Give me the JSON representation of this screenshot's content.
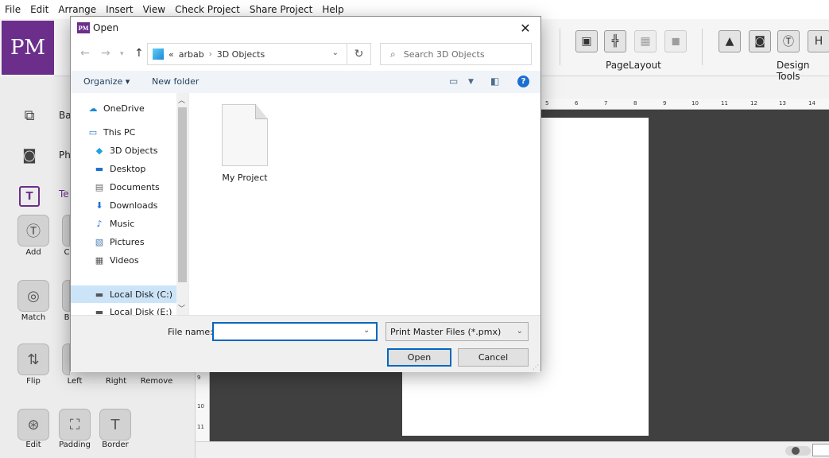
{
  "app": {
    "logo_text": "PM",
    "menu": [
      "File",
      "Edit",
      "Arrange",
      "Insert",
      "View",
      "Check Project",
      "Share Project",
      "Help"
    ],
    "toolbar_groups": [
      "PageLayout",
      "Design Tools"
    ],
    "left_panel": {
      "rows": [
        {
          "label": "Ba",
          "icon": "layers-icon"
        },
        {
          "label": "Ph",
          "icon": "camera-icon"
        },
        {
          "label": "Te",
          "icon": "text-icon"
        }
      ],
      "tools": [
        "Add",
        "C",
        "Match",
        "B",
        "Flip",
        "Left",
        "Right",
        "Remove",
        "Edit",
        "Padding",
        "Border"
      ]
    },
    "ruler_top": [
      "5",
      "6",
      "7",
      "8",
      "9",
      "10",
      "11",
      "12",
      "13",
      "14"
    ],
    "ruler_left": [
      "9",
      "10",
      "11"
    ]
  },
  "dialog": {
    "title": "Open",
    "title_logo": "PM",
    "path": {
      "prefix": "«",
      "segments": [
        "arbab",
        "3D Objects"
      ]
    },
    "search_placeholder": "Search 3D Objects",
    "commands": {
      "organize": "Organize ▾",
      "new_folder": "New folder"
    },
    "nav_items": [
      {
        "label": "OneDrive",
        "icon": "onedrive-icon"
      },
      {
        "label": "This PC",
        "icon": "this-pc-icon"
      },
      {
        "label": "3D Objects",
        "icon": "3d-objects-icon"
      },
      {
        "label": "Desktop",
        "icon": "desktop-icon"
      },
      {
        "label": "Documents",
        "icon": "documents-icon"
      },
      {
        "label": "Downloads",
        "icon": "downloads-icon"
      },
      {
        "label": "Music",
        "icon": "music-icon"
      },
      {
        "label": "Pictures",
        "icon": "pictures-icon"
      },
      {
        "label": "Videos",
        "icon": "videos-icon"
      },
      {
        "label": "Local Disk (C:)",
        "icon": "local-disk-icon",
        "selected": true
      },
      {
        "label": "Local Disk (E:)",
        "icon": "local-disk-icon"
      }
    ],
    "files": [
      {
        "name": "My Project",
        "icon": "file-icon"
      }
    ],
    "file_name_label": "File name:",
    "file_name_value": "",
    "file_type": "Print Master Files (*.pmx)",
    "open_label": "Open",
    "cancel_label": "Cancel"
  },
  "colors": {
    "brand": "#6b2f8b",
    "accent": "#0067c0",
    "selection": "#cce4f7",
    "workspace": "#404040"
  }
}
